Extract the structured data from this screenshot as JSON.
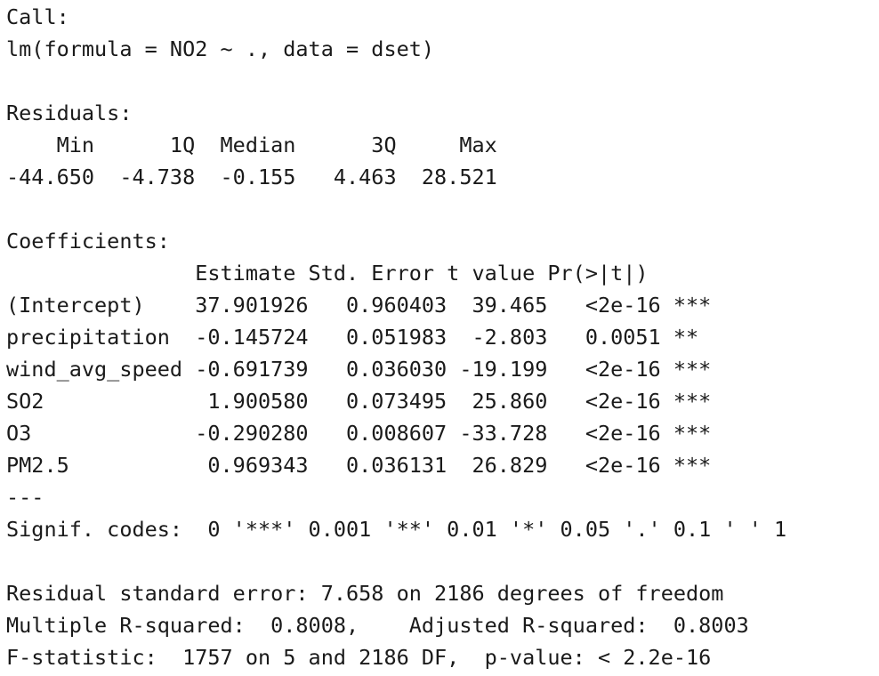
{
  "output": {
    "call_header": "Call:",
    "call_formula": "lm(formula = NO2 ~ ., data = dset)",
    "residuals": {
      "header": "Residuals:",
      "labels_line": "    Min      1Q  Median      3Q     Max ",
      "values_line": "-44.650  -4.738  -0.155   4.463  28.521 "
    },
    "coefficients": {
      "header": "Coefficients:",
      "columns_line": "               Estimate Std. Error t value Pr(>|t|)    ",
      "rows": [
        "(Intercept)    37.901926   0.960403  39.465   <2e-16 ***",
        "precipitation  -0.145724   0.051983  -2.803   0.0051 ** ",
        "wind_avg_speed -0.691739   0.036030 -19.199   <2e-16 ***",
        "SO2             1.900580   0.073495  25.860   <2e-16 ***",
        "O3             -0.290280   0.008607 -33.728   <2e-16 ***",
        "PM2.5           0.969343   0.036131  26.829   <2e-16 ***"
      ]
    },
    "separator": "---",
    "signif_codes": "Signif. codes:  0 '***' 0.001 '**' 0.01 '*' 0.05 '.' 0.1 ' ' 1",
    "residual_std_error": "Residual standard error: 7.658 on 2186 degrees of freedom",
    "r_squared": "Multiple R-squared:  0.8008,\tAdjusted R-squared:  0.8003 ",
    "f_statistic": "F-statistic:  1757 on 5 and 2186 DF,  p-value: < 2.2e-16"
  }
}
